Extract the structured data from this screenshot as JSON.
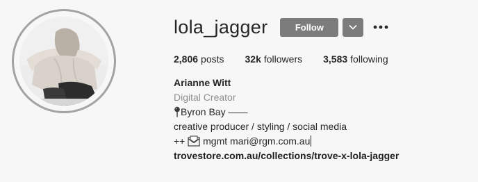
{
  "profile": {
    "username": "lola_jagger",
    "follow_label": "Follow",
    "dropdown_icon": "chevron-down-icon",
    "more_icon": "more-options-icon"
  },
  "stats": {
    "posts_count": "2,806",
    "posts_label": "posts",
    "followers_count": "32k",
    "followers_label": "followers",
    "following_count": "3,583",
    "following_label": "following"
  },
  "bio": {
    "full_name": "Arianne Witt",
    "category": "Digital Creator",
    "location_icon": "pushpin-icon",
    "location": "Byron Bay ——",
    "description": "creative producer / styling / social media",
    "mgmt_prefix": "++",
    "envelope_icon": "envelope-icon",
    "mgmt_text": "mgmt mari@rgm.com.au",
    "link": "trovestore.com.au/collections/trove-x-lola-jagger"
  },
  "colors": {
    "button_bg": "#7c7c7c",
    "category_text": "#8e8e8e",
    "ring": "#a3a3a3"
  }
}
